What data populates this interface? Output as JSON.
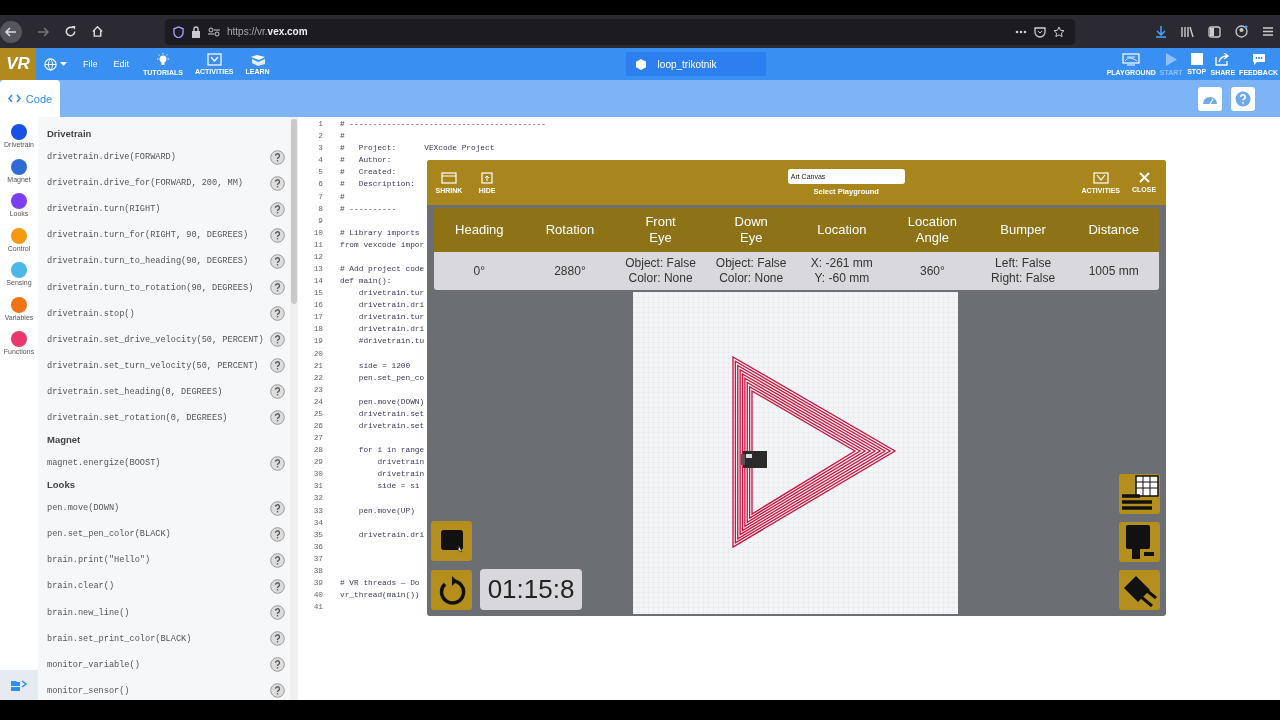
{
  "browser": {
    "url": "https://vr.**vex.com**"
  },
  "app_bar": {
    "logo": "VR",
    "menus": [
      "File",
      "Edit"
    ],
    "tools": [
      {
        "label": "TUTORIALS",
        "kind": "bulb"
      },
      {
        "label": "ACTIVITIES",
        "kind": "activities"
      },
      {
        "label": "LEARN",
        "kind": "learn"
      }
    ],
    "project_name": "loop_trikotnik",
    "actions": [
      {
        "label": "PLAYGROUND",
        "kind": "playground",
        "disabled": false
      },
      {
        "label": "START",
        "kind": "play",
        "disabled": true
      },
      {
        "label": "STOP",
        "kind": "stop",
        "disabled": false
      },
      {
        "label": "SHARE",
        "kind": "share",
        "disabled": false
      },
      {
        "label": "FEEDBACK",
        "kind": "feedback",
        "disabled": false
      }
    ]
  },
  "tabs": [
    {
      "label": "Code",
      "selected": true
    }
  ],
  "categories": [
    {
      "label": "Drivetrain",
      "color": "#1a4fe6"
    },
    {
      "label": "Magnet",
      "color": "#2f6bd6"
    },
    {
      "label": "Looks",
      "color": "#7b3ff0"
    },
    {
      "label": "Control",
      "color": "#f29a12"
    },
    {
      "label": "Sensing",
      "color": "#4bb8e8"
    },
    {
      "label": "Variables",
      "color": "#f07414"
    },
    {
      "label": "Functions",
      "color": "#e8386c"
    }
  ],
  "palette": [
    {
      "title": "Drivetrain",
      "items": [
        "drivetrain.drive(FORWARD)",
        "drivetrain.drive_for(FORWARD, 200, MM)",
        "drivetrain.turn(RIGHT)",
        "drivetrain.turn_for(RIGHT, 90, DEGREES)",
        "drivetrain.turn_to_heading(90, DEGREES)",
        "drivetrain.turn_to_rotation(90, DEGREES)",
        "drivetrain.stop()",
        "drivetrain.set_drive_velocity(50, PERCENT)",
        "drivetrain.set_turn_velocity(50, PERCENT)",
        "drivetrain.set_heading(0, DEGREES)",
        "drivetrain.set_rotation(0, DEGREES)"
      ]
    },
    {
      "title": "Magnet",
      "items": [
        "magnet.energize(BOOST)"
      ]
    },
    {
      "title": "Looks",
      "items": [
        "pen.move(DOWN)",
        "pen.set_pen_color(BLACK)",
        "brain.print(\"Hello\")",
        "brain.clear()",
        "brain.new_line()",
        "brain.set_print_color(BLACK)",
        "monitor_variable()",
        "monitor_sensor()"
      ]
    }
  ],
  "editor": {
    "lines": [
      {
        "number": "1",
        "text": "# ------------------------------------------"
      },
      {
        "number": "2",
        "text": "#"
      },
      {
        "number": "3",
        "text": "#   Project:      VEXcode Project"
      },
      {
        "number": "4",
        "text": "#   Author:"
      },
      {
        "number": "5",
        "text": "#   Created:"
      },
      {
        "number": "6",
        "text": "#   Description:"
      },
      {
        "number": "7",
        "text": "#"
      },
      {
        "number": "8",
        "text": "# ----------"
      },
      {
        "number": "9"
      },
      {
        "number": "10",
        "text": "# Library imports"
      },
      {
        "number": "11",
        "text": "from vexcode impor"
      },
      {
        "number": "12"
      },
      {
        "number": "13",
        "text": "# Add project code"
      },
      {
        "number": "14",
        "text": "def main():"
      },
      {
        "number": "15",
        "text": "    drivetrain.tur"
      },
      {
        "number": "16",
        "text": "    drivetrain.dri"
      },
      {
        "number": "17",
        "text": "    drivetrain.tur"
      },
      {
        "number": "18",
        "text": "    drivetrain.dri"
      },
      {
        "number": "19",
        "text": "    #drivetrain.tu"
      },
      {
        "number": "20"
      },
      {
        "number": "21",
        "text": "    side = 1200"
      },
      {
        "number": "22",
        "text": "    pen.set_pen_co"
      },
      {
        "number": "23"
      },
      {
        "number": "24",
        "text": "    pen.move(DOWN)"
      },
      {
        "number": "25",
        "text": "    drivetrain.set"
      },
      {
        "number": "26",
        "text": "    drivetrain.set"
      },
      {
        "number": "27"
      },
      {
        "number": "28",
        "text": "    for i in range"
      },
      {
        "number": "29",
        "text": "        drivetrain"
      },
      {
        "number": "30",
        "text": "        drivetrain"
      },
      {
        "number": "31",
        "text": "        side = si"
      },
      {
        "number": "32"
      },
      {
        "number": "33",
        "text": "    pen.move(UP)"
      },
      {
        "number": "34"
      },
      {
        "number": "35",
        "text": "    drivetrain.dri"
      },
      {
        "number": "36"
      },
      {
        "number": "37"
      },
      {
        "number": "38"
      },
      {
        "number": "39",
        "text": "# VR threads — Do"
      },
      {
        "number": "40",
        "text": "vr_thread(main())"
      },
      {
        "number": "41"
      }
    ]
  },
  "playground": {
    "left_buttons": [
      {
        "label": "SHRINK",
        "kind": "shrink"
      },
      {
        "label": "HIDE",
        "kind": "hide"
      }
    ],
    "select": {
      "value": "Art Canvas",
      "label": "Select Playground"
    },
    "right_buttons": [
      {
        "label": "ACTIVITIES",
        "kind": "activities"
      },
      {
        "label": "CLOSE",
        "kind": "close"
      }
    ],
    "readings": [
      {
        "header": "Heading",
        "value": "0°"
      },
      {
        "header": "Rotation",
        "value": "2880°"
      },
      {
        "header": "Front\nEye",
        "value": "Object: False\nColor: None"
      },
      {
        "header": "Down\nEye",
        "value": "Object: False\nColor: None"
      },
      {
        "header": "Location",
        "value": "X: -261 mm\nY: -60 mm"
      },
      {
        "header": "Location\nAngle",
        "value": "360°"
      },
      {
        "header": "Bumper",
        "value": "Left: False\nRight: False"
      },
      {
        "header": "Distance",
        "value": "1005 mm"
      }
    ],
    "timer": "01:15:8"
  }
}
